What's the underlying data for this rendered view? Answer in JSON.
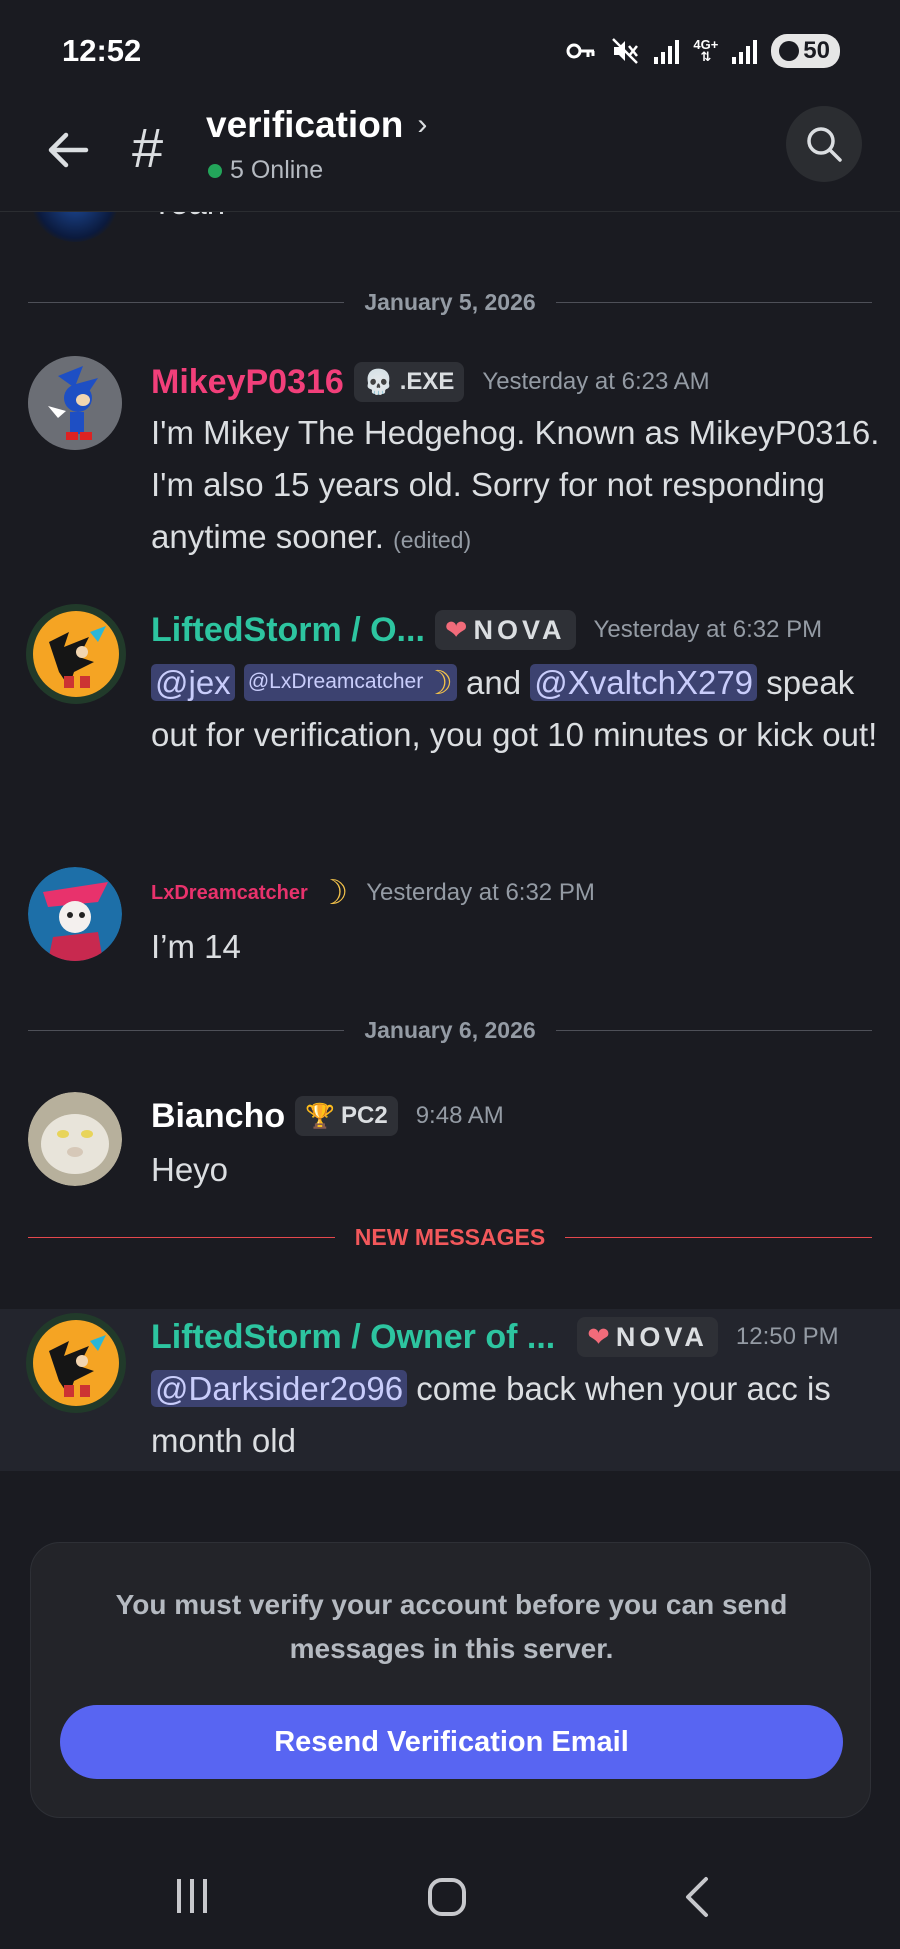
{
  "status_bar": {
    "time": "12:52",
    "icons": [
      "key-icon",
      "mute-icon",
      "signal-icon",
      "network-4g-icon",
      "signal-icon"
    ],
    "network_label": "4G+",
    "battery": "50"
  },
  "header": {
    "channel": "verification",
    "online": "5 Online",
    "online_color": "#23a55a"
  },
  "partial_message": {
    "text": "Yeah"
  },
  "dividers": {
    "jan5": "January 5, 2026",
    "jan6": "January 6, 2026",
    "new_messages": "NEW MESSAGES"
  },
  "messages": [
    {
      "author": "MikeyP0316",
      "author_color": "#f23f7a",
      "tag": ".EXE",
      "timestamp": "Yesterday at 6:23 AM",
      "text": "I'm Mikey The Hedgehog. Known as MikeyP0316. I'm also 15 years old. Sorry for not responding anytime sooner.",
      "edited": "(edited)"
    },
    {
      "author": "LiftedStorm / O...",
      "author_color": "#2dc5a0",
      "tag": "NOVA",
      "timestamp": "Yesterday at 6:32 PM",
      "mentions": [
        "@jex",
        "@LxDreamcatcher",
        "@XvaltchX279"
      ],
      "joiner": "and",
      "text": "speak out for verification, you got 10 minutes or kick out!"
    },
    {
      "author": "LxDreamcatcher",
      "author_color": "#e8326c",
      "timestamp": "Yesterday at 6:32 PM",
      "text": "I’m 14"
    },
    {
      "author": "Biancho",
      "author_color": "#ffffff",
      "tag": "PC2",
      "timestamp": "9:48 AM",
      "text": "Heyo"
    },
    {
      "author": "LiftedStorm / Owner of ...",
      "author_color": "#2dc5a0",
      "tag": "NOVA",
      "timestamp": "12:50 PM",
      "mention": "@Darksider2o96",
      "text": "come back when your acc is month old"
    }
  ],
  "verify": {
    "text": "You must verify your account before you can send messages in this server.",
    "button": "Resend Verification Email",
    "button_color": "#5865f2"
  }
}
